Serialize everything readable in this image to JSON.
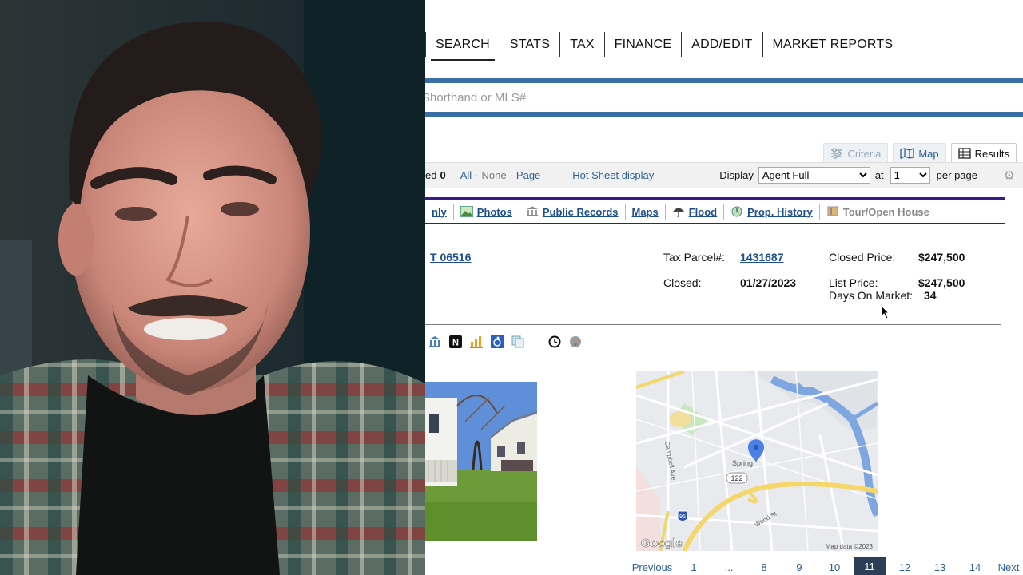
{
  "nav": {
    "items": [
      "SEARCH",
      "STATS",
      "TAX",
      "FINANCE",
      "ADD/EDIT",
      "MARKET REPORTS"
    ],
    "active": "SEARCH"
  },
  "search": {
    "placeholder": "Shorthand or MLS#"
  },
  "view_tabs": {
    "criteria": "Criteria",
    "map": "Map",
    "results": "Results"
  },
  "toolbar": {
    "selected_label": "ed",
    "selected_count": "0",
    "all": "All",
    "none": "None",
    "page": "Page",
    "hot_sheet": "Hot Sheet display",
    "display_label": "Display",
    "display_value": "Agent Full",
    "at_label": "at",
    "per_page_value": "1",
    "per_page_label": "per page"
  },
  "link_tabs": {
    "only": "nly",
    "photos": "Photos",
    "public_records": "Public Records",
    "maps": "Maps",
    "flood": "Flood",
    "prop_history": "Prop. History",
    "tour_open_house": "Tour/Open House"
  },
  "listing": {
    "address_partial": "T 06516",
    "tax_parcel_label": "Tax Parcel#:",
    "tax_parcel_value": "1431687",
    "closed_label": "Closed:",
    "closed_value": "01/27/2023",
    "closed_price_label": "Closed Price:",
    "closed_price_value": "$247,500",
    "list_price_label": "List Price:",
    "list_price_value": "$247,500",
    "dom_label": "Days On Market:",
    "dom_value": "34"
  },
  "map": {
    "road_label_1": "Campbell Ave",
    "road_label_2": "Spring",
    "route_badge": "122",
    "interstate_badge": "95",
    "road_label_3": "Wood St",
    "logo": "Google",
    "attribution": "Map data ©2023"
  },
  "pagination": {
    "previous": "Previous",
    "pages": [
      "1",
      "...",
      "8",
      "9",
      "10",
      "11",
      "12",
      "13",
      "14"
    ],
    "current": "11",
    "next": "Next"
  },
  "colors": {
    "accent_blue": "#3b6ea5",
    "link_blue": "#1c4f8c",
    "tab_border_purple": "#3a1a8a",
    "pager_current": "#2c3e55"
  }
}
